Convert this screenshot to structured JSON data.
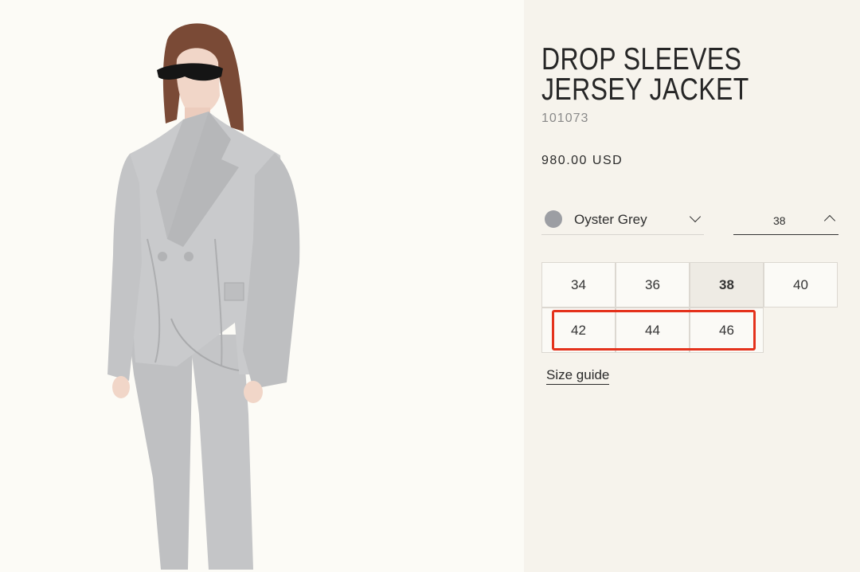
{
  "product": {
    "title": "DROP SLEEVES JERSEY JACKET",
    "sku": "101073",
    "price": "980.00 USD"
  },
  "color": {
    "label": "Oyster Grey",
    "swatch": "#9c9ea3"
  },
  "size": {
    "selected": "38",
    "options": [
      "34",
      "36",
      "38",
      "40",
      "42",
      "44",
      "46"
    ]
  },
  "links": {
    "size_guide": "Size guide"
  },
  "colors": {
    "highlight": "#e4321c",
    "info_background": "#f6f3ec",
    "image_background": "#fcfbf6"
  }
}
